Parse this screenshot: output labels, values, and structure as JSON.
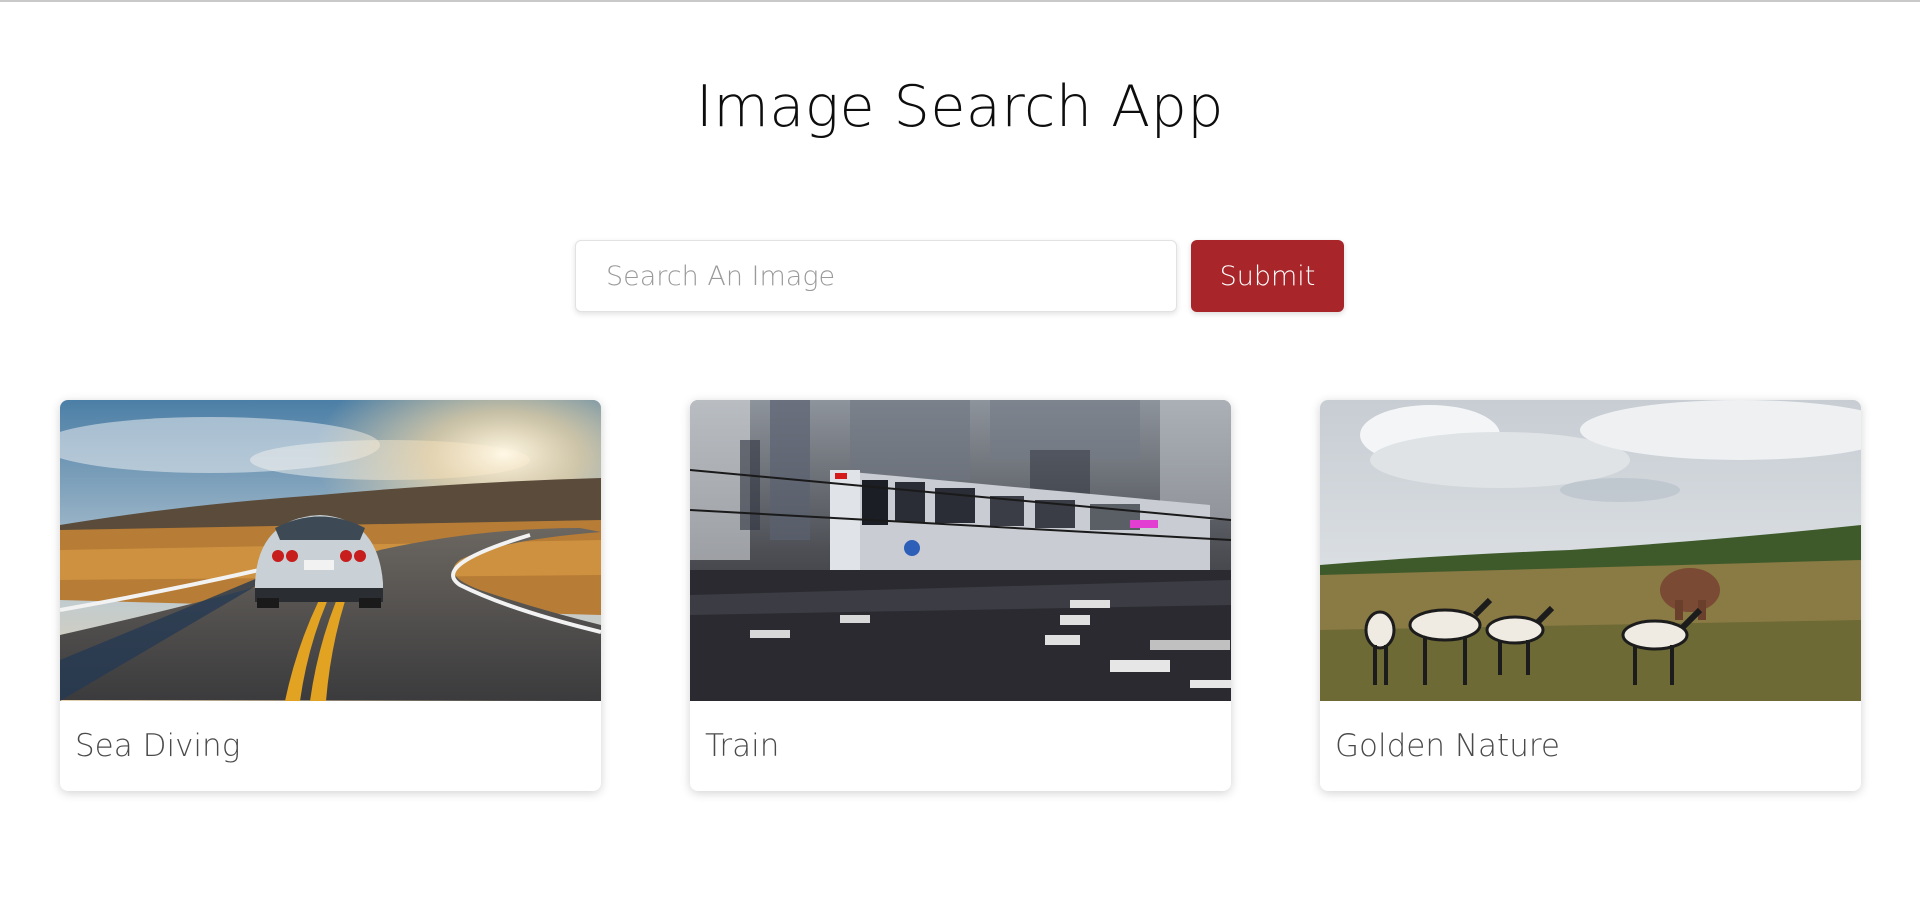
{
  "header": {
    "title": "Image Search App"
  },
  "search": {
    "placeholder": "Search An Image",
    "value": "",
    "submit_label": "Submit"
  },
  "colors": {
    "submit_bg": "#a8252a"
  },
  "results": [
    {
      "title": "Sea Diving",
      "image": "car-on-road-sunset-image"
    },
    {
      "title": "Train",
      "image": "elevated-train-motion-image"
    },
    {
      "title": "Golden Nature",
      "image": "zebras-and-elephant-savanna-image"
    }
  ]
}
